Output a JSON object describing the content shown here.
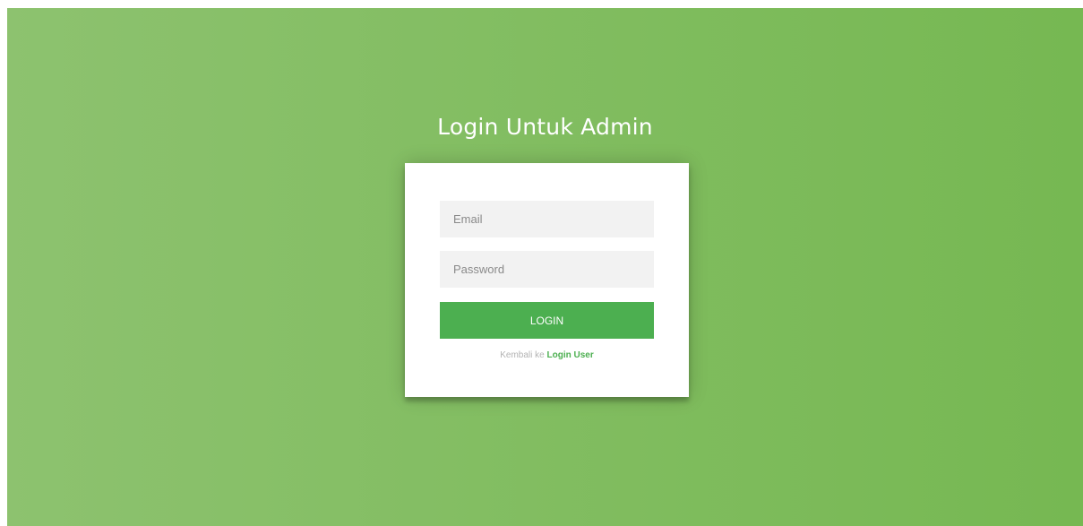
{
  "page": {
    "title": "Login Untuk Admin"
  },
  "form": {
    "email": {
      "placeholder": "Email",
      "value": ""
    },
    "password": {
      "placeholder": "Password",
      "value": ""
    },
    "login_label": "LOGIN",
    "footer": {
      "prefix": "Kembali ke",
      "link_label": "Login User"
    }
  },
  "colors": {
    "gradient_start": "#8dc26f",
    "gradient_end": "#76b852",
    "button": "#4caf50",
    "link": "#4caf50",
    "input_background": "#f2f2f2"
  }
}
